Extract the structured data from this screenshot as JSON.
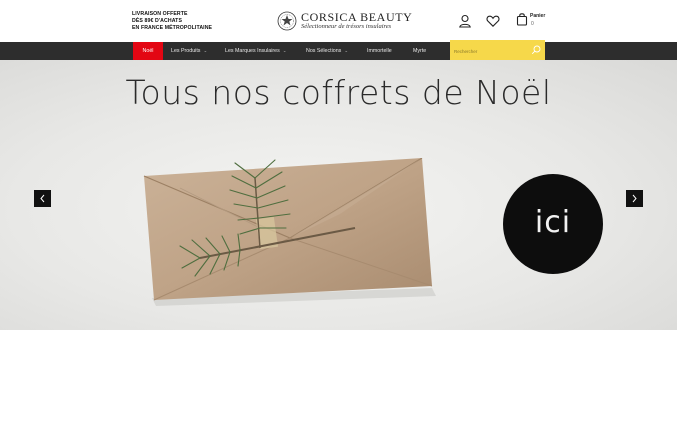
{
  "header": {
    "shipping_lines": [
      "LIVRAISON OFFERTE",
      "DÈS 89€ D'ACHATS",
      "EN FRANCE MÉTROPOLITAINE"
    ],
    "logo_title": "CORSICA BEAUTY",
    "logo_subtitle": "Sélectionneur de trésors insulaires",
    "cart_label": "Panier",
    "cart_count": "0",
    "icons": [
      "account-icon",
      "heart-icon",
      "shopping-bag-icon"
    ]
  },
  "nav": {
    "items": [
      {
        "label": "Noël",
        "has_dropdown": false,
        "active": true
      },
      {
        "label": "Les Produits",
        "has_dropdown": true
      },
      {
        "label": "Les Marques Insulaires",
        "has_dropdown": true
      },
      {
        "label": "Nos Sélections",
        "has_dropdown": true
      },
      {
        "label": "Immortelle",
        "has_dropdown": false
      },
      {
        "label": "Myrte",
        "has_dropdown": false
      }
    ],
    "search_placeholder": "Rechercher"
  },
  "hero": {
    "title": "Tous nos coffrets de Noël",
    "badge": "ici"
  },
  "colors": {
    "accent_red": "#e30613",
    "nav_bg": "#2d2d2d",
    "search_bg": "#f6d84a",
    "badge_bg": "#0d0d0d"
  }
}
